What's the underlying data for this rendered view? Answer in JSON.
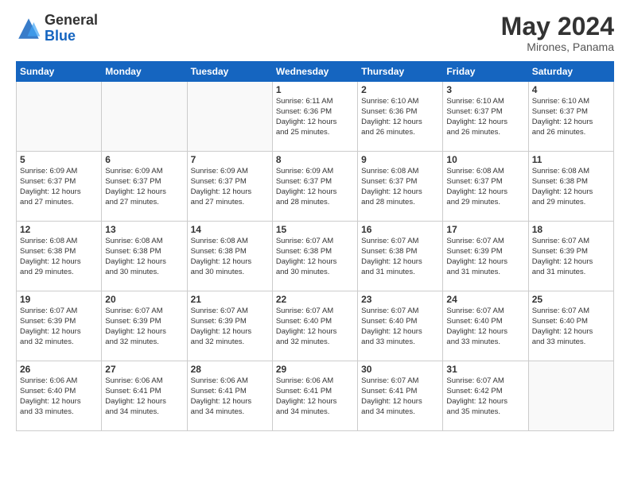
{
  "header": {
    "logo_general": "General",
    "logo_blue": "Blue",
    "month_year": "May 2024",
    "location": "Mirones, Panama"
  },
  "weekdays": [
    "Sunday",
    "Monday",
    "Tuesday",
    "Wednesday",
    "Thursday",
    "Friday",
    "Saturday"
  ],
  "weeks": [
    [
      {
        "day": "",
        "info": ""
      },
      {
        "day": "",
        "info": ""
      },
      {
        "day": "",
        "info": ""
      },
      {
        "day": "1",
        "info": "Sunrise: 6:11 AM\nSunset: 6:36 PM\nDaylight: 12 hours\nand 25 minutes."
      },
      {
        "day": "2",
        "info": "Sunrise: 6:10 AM\nSunset: 6:36 PM\nDaylight: 12 hours\nand 26 minutes."
      },
      {
        "day": "3",
        "info": "Sunrise: 6:10 AM\nSunset: 6:37 PM\nDaylight: 12 hours\nand 26 minutes."
      },
      {
        "day": "4",
        "info": "Sunrise: 6:10 AM\nSunset: 6:37 PM\nDaylight: 12 hours\nand 26 minutes."
      }
    ],
    [
      {
        "day": "5",
        "info": "Sunrise: 6:09 AM\nSunset: 6:37 PM\nDaylight: 12 hours\nand 27 minutes."
      },
      {
        "day": "6",
        "info": "Sunrise: 6:09 AM\nSunset: 6:37 PM\nDaylight: 12 hours\nand 27 minutes."
      },
      {
        "day": "7",
        "info": "Sunrise: 6:09 AM\nSunset: 6:37 PM\nDaylight: 12 hours\nand 27 minutes."
      },
      {
        "day": "8",
        "info": "Sunrise: 6:09 AM\nSunset: 6:37 PM\nDaylight: 12 hours\nand 28 minutes."
      },
      {
        "day": "9",
        "info": "Sunrise: 6:08 AM\nSunset: 6:37 PM\nDaylight: 12 hours\nand 28 minutes."
      },
      {
        "day": "10",
        "info": "Sunrise: 6:08 AM\nSunset: 6:37 PM\nDaylight: 12 hours\nand 29 minutes."
      },
      {
        "day": "11",
        "info": "Sunrise: 6:08 AM\nSunset: 6:38 PM\nDaylight: 12 hours\nand 29 minutes."
      }
    ],
    [
      {
        "day": "12",
        "info": "Sunrise: 6:08 AM\nSunset: 6:38 PM\nDaylight: 12 hours\nand 29 minutes."
      },
      {
        "day": "13",
        "info": "Sunrise: 6:08 AM\nSunset: 6:38 PM\nDaylight: 12 hours\nand 30 minutes."
      },
      {
        "day": "14",
        "info": "Sunrise: 6:08 AM\nSunset: 6:38 PM\nDaylight: 12 hours\nand 30 minutes."
      },
      {
        "day": "15",
        "info": "Sunrise: 6:07 AM\nSunset: 6:38 PM\nDaylight: 12 hours\nand 30 minutes."
      },
      {
        "day": "16",
        "info": "Sunrise: 6:07 AM\nSunset: 6:38 PM\nDaylight: 12 hours\nand 31 minutes."
      },
      {
        "day": "17",
        "info": "Sunrise: 6:07 AM\nSunset: 6:39 PM\nDaylight: 12 hours\nand 31 minutes."
      },
      {
        "day": "18",
        "info": "Sunrise: 6:07 AM\nSunset: 6:39 PM\nDaylight: 12 hours\nand 31 minutes."
      }
    ],
    [
      {
        "day": "19",
        "info": "Sunrise: 6:07 AM\nSunset: 6:39 PM\nDaylight: 12 hours\nand 32 minutes."
      },
      {
        "day": "20",
        "info": "Sunrise: 6:07 AM\nSunset: 6:39 PM\nDaylight: 12 hours\nand 32 minutes."
      },
      {
        "day": "21",
        "info": "Sunrise: 6:07 AM\nSunset: 6:39 PM\nDaylight: 12 hours\nand 32 minutes."
      },
      {
        "day": "22",
        "info": "Sunrise: 6:07 AM\nSunset: 6:40 PM\nDaylight: 12 hours\nand 32 minutes."
      },
      {
        "day": "23",
        "info": "Sunrise: 6:07 AM\nSunset: 6:40 PM\nDaylight: 12 hours\nand 33 minutes."
      },
      {
        "day": "24",
        "info": "Sunrise: 6:07 AM\nSunset: 6:40 PM\nDaylight: 12 hours\nand 33 minutes."
      },
      {
        "day": "25",
        "info": "Sunrise: 6:07 AM\nSunset: 6:40 PM\nDaylight: 12 hours\nand 33 minutes."
      }
    ],
    [
      {
        "day": "26",
        "info": "Sunrise: 6:06 AM\nSunset: 6:40 PM\nDaylight: 12 hours\nand 33 minutes."
      },
      {
        "day": "27",
        "info": "Sunrise: 6:06 AM\nSunset: 6:41 PM\nDaylight: 12 hours\nand 34 minutes."
      },
      {
        "day": "28",
        "info": "Sunrise: 6:06 AM\nSunset: 6:41 PM\nDaylight: 12 hours\nand 34 minutes."
      },
      {
        "day": "29",
        "info": "Sunrise: 6:06 AM\nSunset: 6:41 PM\nDaylight: 12 hours\nand 34 minutes."
      },
      {
        "day": "30",
        "info": "Sunrise: 6:07 AM\nSunset: 6:41 PM\nDaylight: 12 hours\nand 34 minutes."
      },
      {
        "day": "31",
        "info": "Sunrise: 6:07 AM\nSunset: 6:42 PM\nDaylight: 12 hours\nand 35 minutes."
      },
      {
        "day": "",
        "info": ""
      }
    ]
  ]
}
